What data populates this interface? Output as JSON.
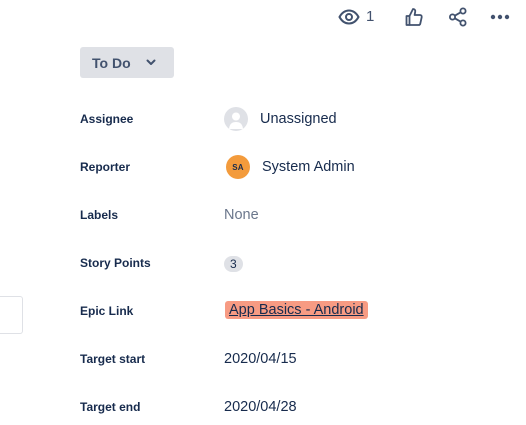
{
  "toolbar": {
    "watch_icon": "eye-icon",
    "watch_count": "1",
    "like_icon": "thumbs-up-icon",
    "share_icon": "share-icon",
    "more_icon": "more-horizontal-icon"
  },
  "status": {
    "label": "To Do",
    "icon": "chevron-down-icon"
  },
  "fields": {
    "assignee": {
      "label": "Assignee",
      "value": "Unassigned"
    },
    "reporter": {
      "label": "Reporter",
      "value": "System Admin",
      "initials": "SA"
    },
    "labels": {
      "label": "Labels",
      "value": "None"
    },
    "story_points": {
      "label": "Story Points",
      "value": "3"
    },
    "epic_link": {
      "label": "Epic Link",
      "value": "App Basics - Android"
    },
    "target_start": {
      "label": "Target start",
      "value": "2020/04/15"
    },
    "target_end": {
      "label": "Target end",
      "value": "2020/04/28"
    }
  },
  "colors": {
    "status_bg": "#dfe1e6",
    "reporter_avatar": "#f39b3c",
    "epic_color": "#f79b83",
    "text": "#172b4d",
    "muted": "#6b778c"
  }
}
